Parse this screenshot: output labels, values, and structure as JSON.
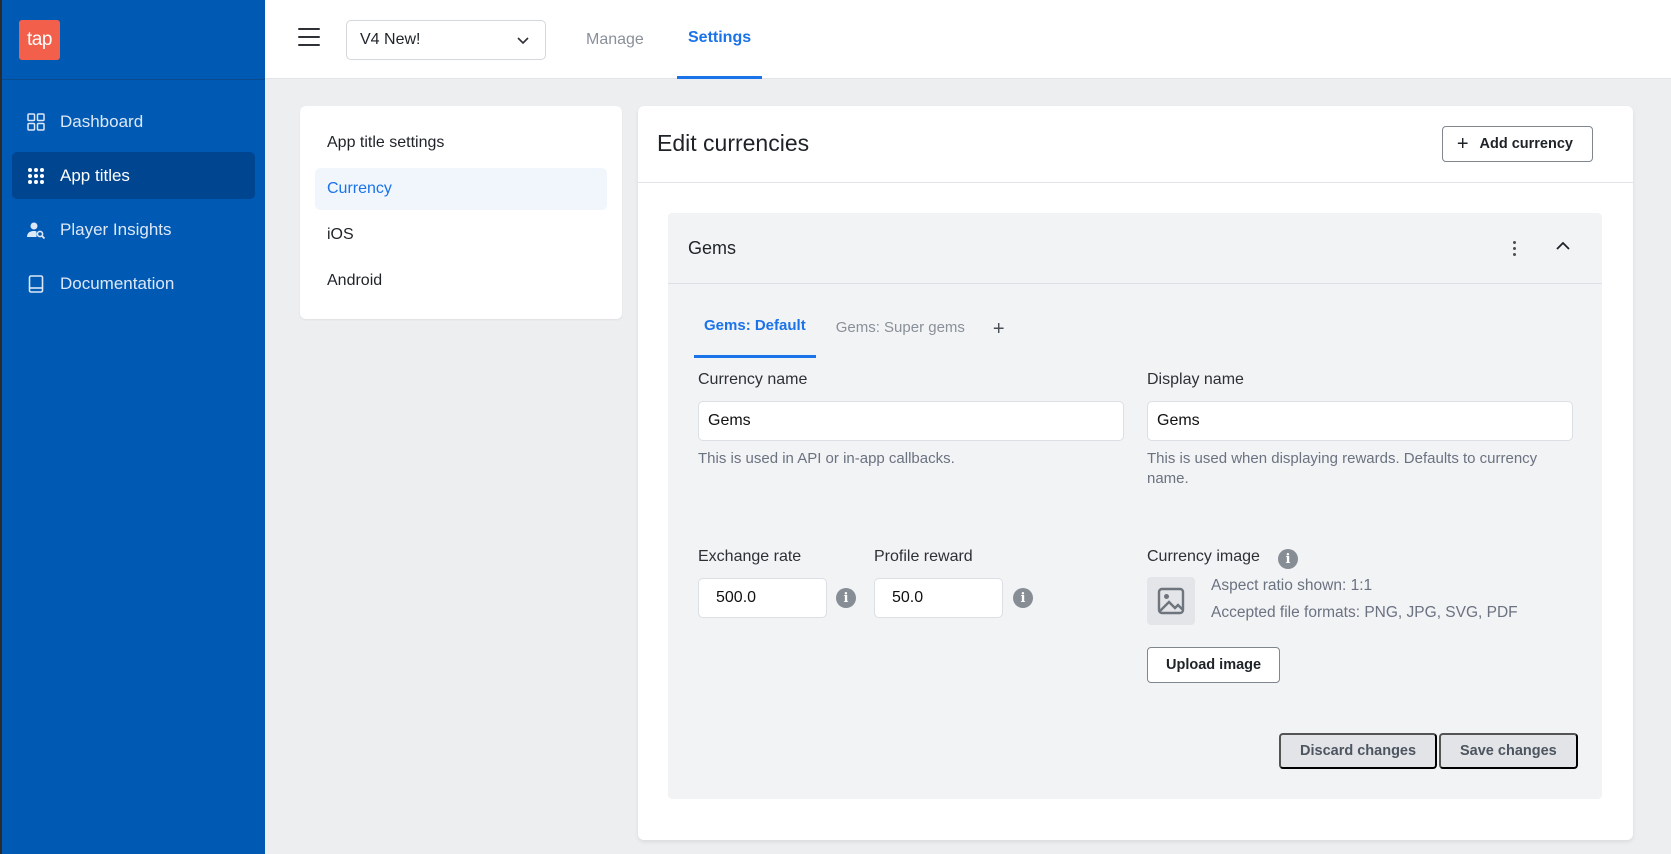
{
  "sidebar": {
    "logo_text": "tap",
    "items": [
      {
        "label": "Dashboard",
        "icon": "dashboard-grid-icon",
        "active": false
      },
      {
        "label": "App titles",
        "icon": "apps-dots-icon",
        "active": true
      },
      {
        "label": "Player Insights",
        "icon": "user-search-icon",
        "active": false
      },
      {
        "label": "Documentation",
        "icon": "book-icon",
        "active": false
      }
    ]
  },
  "topbar": {
    "app_select_value": "V4 New!",
    "tabs": [
      {
        "label": "Manage",
        "active": false
      },
      {
        "label": "Settings",
        "active": true
      }
    ]
  },
  "subnav": {
    "items": [
      {
        "label": "App title settings",
        "active": false
      },
      {
        "label": "Currency",
        "active": true
      },
      {
        "label": "iOS",
        "active": false
      },
      {
        "label": "Android",
        "active": false
      }
    ]
  },
  "main": {
    "title": "Edit currencies",
    "add_button_label": "Add currency",
    "currency": {
      "title": "Gems",
      "tabs": [
        {
          "label": "Gems: Default",
          "active": true
        },
        {
          "label": "Gems: Super gems",
          "active": false
        }
      ],
      "add_tab_label": "+",
      "currency_name": {
        "label": "Currency name",
        "value": "Gems",
        "help": "This is used in API or in-app callbacks."
      },
      "display_name": {
        "label": "Display name",
        "value": "Gems",
        "help": "This is used when displaying rewards. Defaults to currency name."
      },
      "exchange_rate": {
        "label": "Exchange rate",
        "value": "500.0"
      },
      "profile_reward": {
        "label": "Profile reward",
        "value": "50.0"
      },
      "currency_image": {
        "label": "Currency image",
        "aspect_ratio": "Aspect ratio shown: 1:1",
        "formats": "Accepted file formats: PNG, JPG, SVG, PDF",
        "upload_label": "Upload image"
      },
      "discard_label": "Discard changes",
      "save_label": "Save changes"
    }
  },
  "colors": {
    "sidebar_bg": "#0059b3",
    "sidebar_active": "#00458f",
    "accent": "#1a73e8",
    "logo_bg": "#f2604c"
  }
}
